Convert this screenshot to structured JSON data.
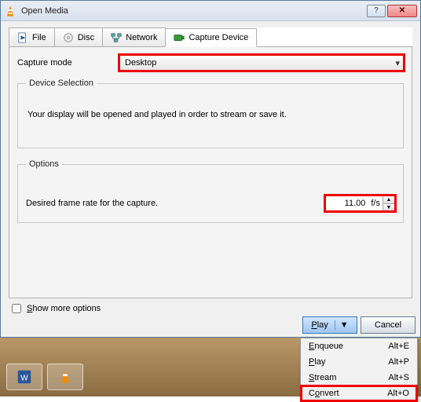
{
  "window": {
    "title": "Open Media"
  },
  "tabs": {
    "file": "File",
    "disc": "Disc",
    "network": "Network",
    "capture": "Capture Device"
  },
  "capture": {
    "mode_label": "Capture mode",
    "mode_value": "Desktop",
    "device_section": "Device Selection",
    "device_text": "Your display will be opened and played in order to stream or save it.",
    "options_section": "Options",
    "fps_label": "Desired frame rate for the capture.",
    "fps_value": "11.00",
    "fps_unit": "f/s"
  },
  "more_options": "Show more options",
  "buttons": {
    "play": "Play",
    "cancel": "Cancel"
  },
  "menu": {
    "enqueue": {
      "label": "Enqueue",
      "accel": "Alt+E"
    },
    "play": {
      "label": "Play",
      "accel": "Alt+P"
    },
    "stream": {
      "label": "Stream",
      "accel": "Alt+S"
    },
    "convert": {
      "label": "Convert",
      "accel": "Alt+O"
    }
  }
}
